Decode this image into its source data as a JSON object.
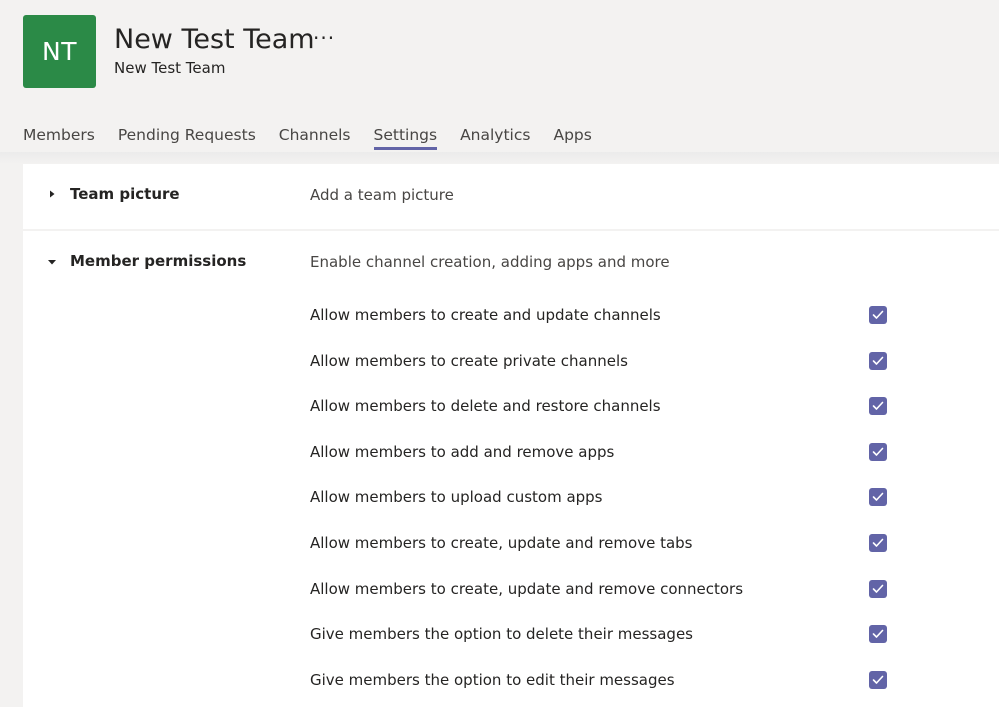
{
  "team": {
    "initials": "NT",
    "title": "New Test Team",
    "subtitle": "New Test Team",
    "more_glyph": "···",
    "avatar_color": "#2b8a47"
  },
  "tabs": [
    {
      "label": "Members",
      "active": false
    },
    {
      "label": "Pending Requests",
      "active": false
    },
    {
      "label": "Channels",
      "active": false
    },
    {
      "label": "Settings",
      "active": true
    },
    {
      "label": "Analytics",
      "active": false
    },
    {
      "label": "Apps",
      "active": false
    }
  ],
  "sections": [
    {
      "label": "Team picture",
      "description": "Add a team picture",
      "expanded": false,
      "icon": "caret-right-icon"
    },
    {
      "label": "Member permissions",
      "description": "Enable channel creation, adding apps and more",
      "expanded": true,
      "icon": "caret-down-icon"
    }
  ],
  "permissions": [
    {
      "label": "Allow members to create and update channels",
      "checked": true
    },
    {
      "label": "Allow members to create private channels",
      "checked": true
    },
    {
      "label": "Allow members to delete and restore channels",
      "checked": true
    },
    {
      "label": "Allow members to add and remove apps",
      "checked": true
    },
    {
      "label": "Allow members to upload custom apps",
      "checked": true
    },
    {
      "label": "Allow members to create, update and remove tabs",
      "checked": true
    },
    {
      "label": "Allow members to create, update and remove connectors",
      "checked": true
    },
    {
      "label": "Give members the option to delete their messages",
      "checked": true
    },
    {
      "label": "Give members the option to edit their messages",
      "checked": true
    }
  ],
  "colors": {
    "accent": "#6264a7",
    "background": "#f3f2f1",
    "panel": "#ffffff"
  }
}
